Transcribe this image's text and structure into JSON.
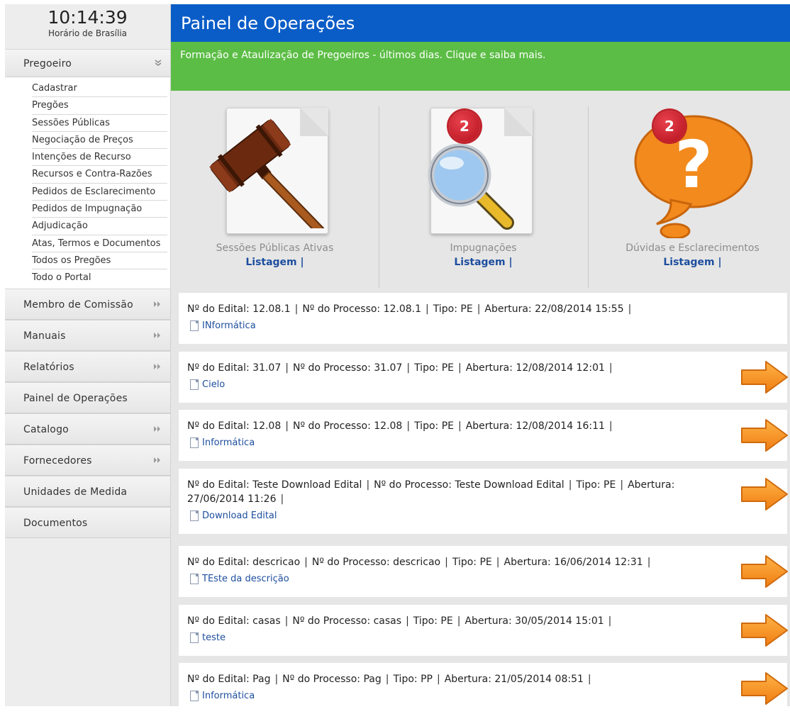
{
  "clock": {
    "time": "10:14:39",
    "zone": "Horário de Brasília"
  },
  "sidebar": {
    "pregoeiro": {
      "label": "Pregoeiro",
      "items": [
        "Cadastrar",
        "Pregões",
        "Sessões Públicas",
        "Negociação de Preços",
        "Intenções de Recurso",
        "Recursos e Contra-Razões",
        "Pedidos de Esclarecimento",
        "Pedidos de Impugnação",
        "Adjudicação",
        "Atas, Termos e Documentos",
        "Todos os Pregões",
        "Todo o Portal"
      ]
    },
    "menus": [
      {
        "label": "Membro de Comissão",
        "arrow": "⏩"
      },
      {
        "label": "Manuais",
        "arrow": "⏩"
      },
      {
        "label": "Relatórios",
        "arrow": "⏩"
      },
      {
        "label": "Painel de Operações",
        "arrow": ""
      },
      {
        "label": "Catalogo",
        "arrow": "⏩"
      },
      {
        "label": "Fornecedores",
        "arrow": "⏩"
      },
      {
        "label": "Unidades de Medida",
        "arrow": ""
      },
      {
        "label": "Documentos",
        "arrow": ""
      }
    ]
  },
  "header": {
    "title": "Painel de Operações",
    "news": "Formação e Ataulização de Pregoeiros - últimos dias. Clique e saiba mais."
  },
  "panel": [
    {
      "caption": "Sessões Públicas Ativas",
      "link": "Listagem |",
      "badge": "",
      "icon": "gavel-icon"
    },
    {
      "caption": "Impugnações",
      "link": "Listagem |",
      "badge": "2",
      "icon": "magnifier-icon"
    },
    {
      "caption": "Dúvidas e Esclarecimentos",
      "link": "Listagem |",
      "badge": "2",
      "icon": "question-icon"
    }
  ],
  "labels": {
    "edital": "Nº do Edital:",
    "processo": "Nº do Processo:",
    "tipo": "Tipo:",
    "abertura": "Abertura:"
  },
  "records": [
    {
      "edital": "12.08.1",
      "processo": "12.08.1",
      "tipo": "PE",
      "abertura": "22/08/2014 15:55",
      "doc": "INformática",
      "arrow": false
    },
    {
      "edital": "31.07",
      "processo": "31.07",
      "tipo": "PE",
      "abertura": "12/08/2014 12:01",
      "doc": "Cielo",
      "arrow": true
    },
    {
      "edital": "12.08",
      "processo": "12.08",
      "tipo": "PE",
      "abertura": "12/08/2014 16:11",
      "doc": "Informática",
      "arrow": true
    },
    {
      "edital": "Teste Download Edital",
      "processo": "Teste Download Edital",
      "tipo": "PE",
      "abertura": "27/06/2014 11:26",
      "doc": "Download Edital",
      "arrow": true
    },
    {
      "edital": "descricao",
      "processo": "descricao",
      "tipo": "PE",
      "abertura": "16/06/2014 12:31",
      "doc": "TEste da descrição",
      "arrow": true
    },
    {
      "edital": "casas",
      "processo": "casas",
      "tipo": "PE",
      "abertura": "30/05/2014 15:01",
      "doc": "teste",
      "arrow": true
    },
    {
      "edital": "Pag",
      "processo": "Pag",
      "tipo": "PP",
      "abertura": "21/05/2014 08:51",
      "doc": "Informática",
      "arrow": true
    }
  ]
}
